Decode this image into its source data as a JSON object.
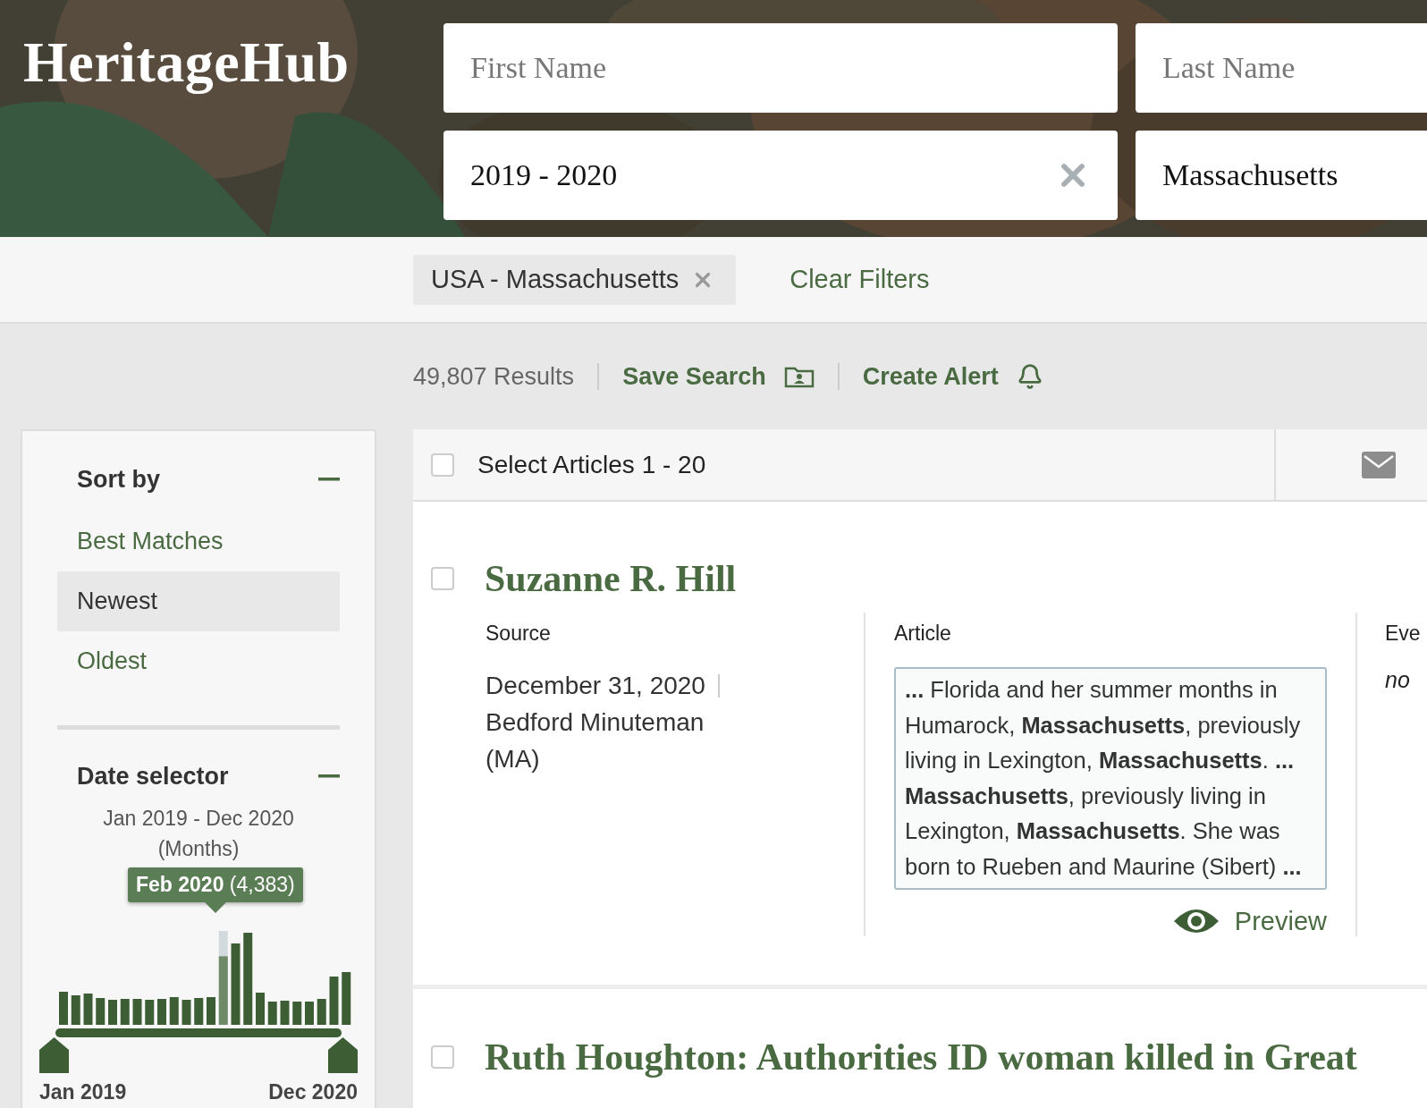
{
  "logo": "HeritageHub",
  "search": {
    "fields": [
      {
        "kind": "text",
        "placeholder": "First Name"
      },
      {
        "kind": "text",
        "placeholder": "Last Name"
      },
      {
        "kind": "clearable",
        "value": "2019 - 2020"
      },
      {
        "kind": "text",
        "value": "Massachusetts"
      }
    ]
  },
  "filters": {
    "chips": [
      {
        "label": "USA - Massachusetts"
      }
    ],
    "clear_label": "Clear Filters"
  },
  "results_bar": {
    "count": "49,807 Results",
    "actions": [
      {
        "kind": "save",
        "label": "Save Search"
      },
      {
        "kind": "alert",
        "label": "Create Alert"
      }
    ]
  },
  "sidebar": {
    "sort": {
      "title": "Sort by",
      "expanded": true,
      "options": [
        {
          "label": "Best Matches",
          "selected": false
        },
        {
          "label": "Newest",
          "selected": true
        },
        {
          "label": "Oldest",
          "selected": false
        }
      ]
    },
    "date": {
      "title": "Date selector",
      "expanded": true,
      "range": "Jan 2019 - Dec 2020",
      "unit": "(Months)",
      "tooltip": "**Feb 2020** (4,383)",
      "start": "Jan 2019",
      "end": "Dec 2020",
      "bars": [
        {
          "selected": false
        },
        {
          "selected": false
        },
        {
          "selected": false
        },
        {
          "selected": false
        },
        {
          "selected": false
        },
        {
          "selected": false
        },
        {
          "selected": false
        },
        {
          "selected": false
        },
        {
          "selected": false
        },
        {
          "selected": false
        },
        {
          "selected": false
        },
        {
          "selected": false
        },
        {
          "selected": false
        },
        {
          "selected": true
        },
        {
          "selected": false
        },
        {
          "selected": false
        },
        {
          "selected": false
        },
        {
          "selected": false
        },
        {
          "selected": false
        },
        {
          "selected": false
        },
        {
          "selected": false
        },
        {
          "selected": false
        },
        {
          "selected": false
        },
        {
          "selected": false
        }
      ]
    }
  },
  "results": {
    "select_label": "Select Articles 1 - 20",
    "select_checked": false,
    "articles": [
      {
        "title": "Suzanne R. Hill",
        "checked": false,
        "source_label": "Source",
        "date": "December 31, 2020",
        "paper": "Bedford Minuteman (MA)",
        "article_label": "Article",
        "snippet": "**...** Florida and her summer months in Humarock, **Massachusetts**, previously living in Lexington, **Massachusetts**. **...** **Massachusetts**, previously living in Lexington, **Massachusetts**. She was born to Rueben and Maurine (Sibert) **...**",
        "preview": "Preview",
        "events_label": "Eve",
        "events_value": "no"
      },
      {
        "title": "Ruth Houghton: Authorities ID woman killed in Great",
        "checked": false
      }
    ]
  }
}
